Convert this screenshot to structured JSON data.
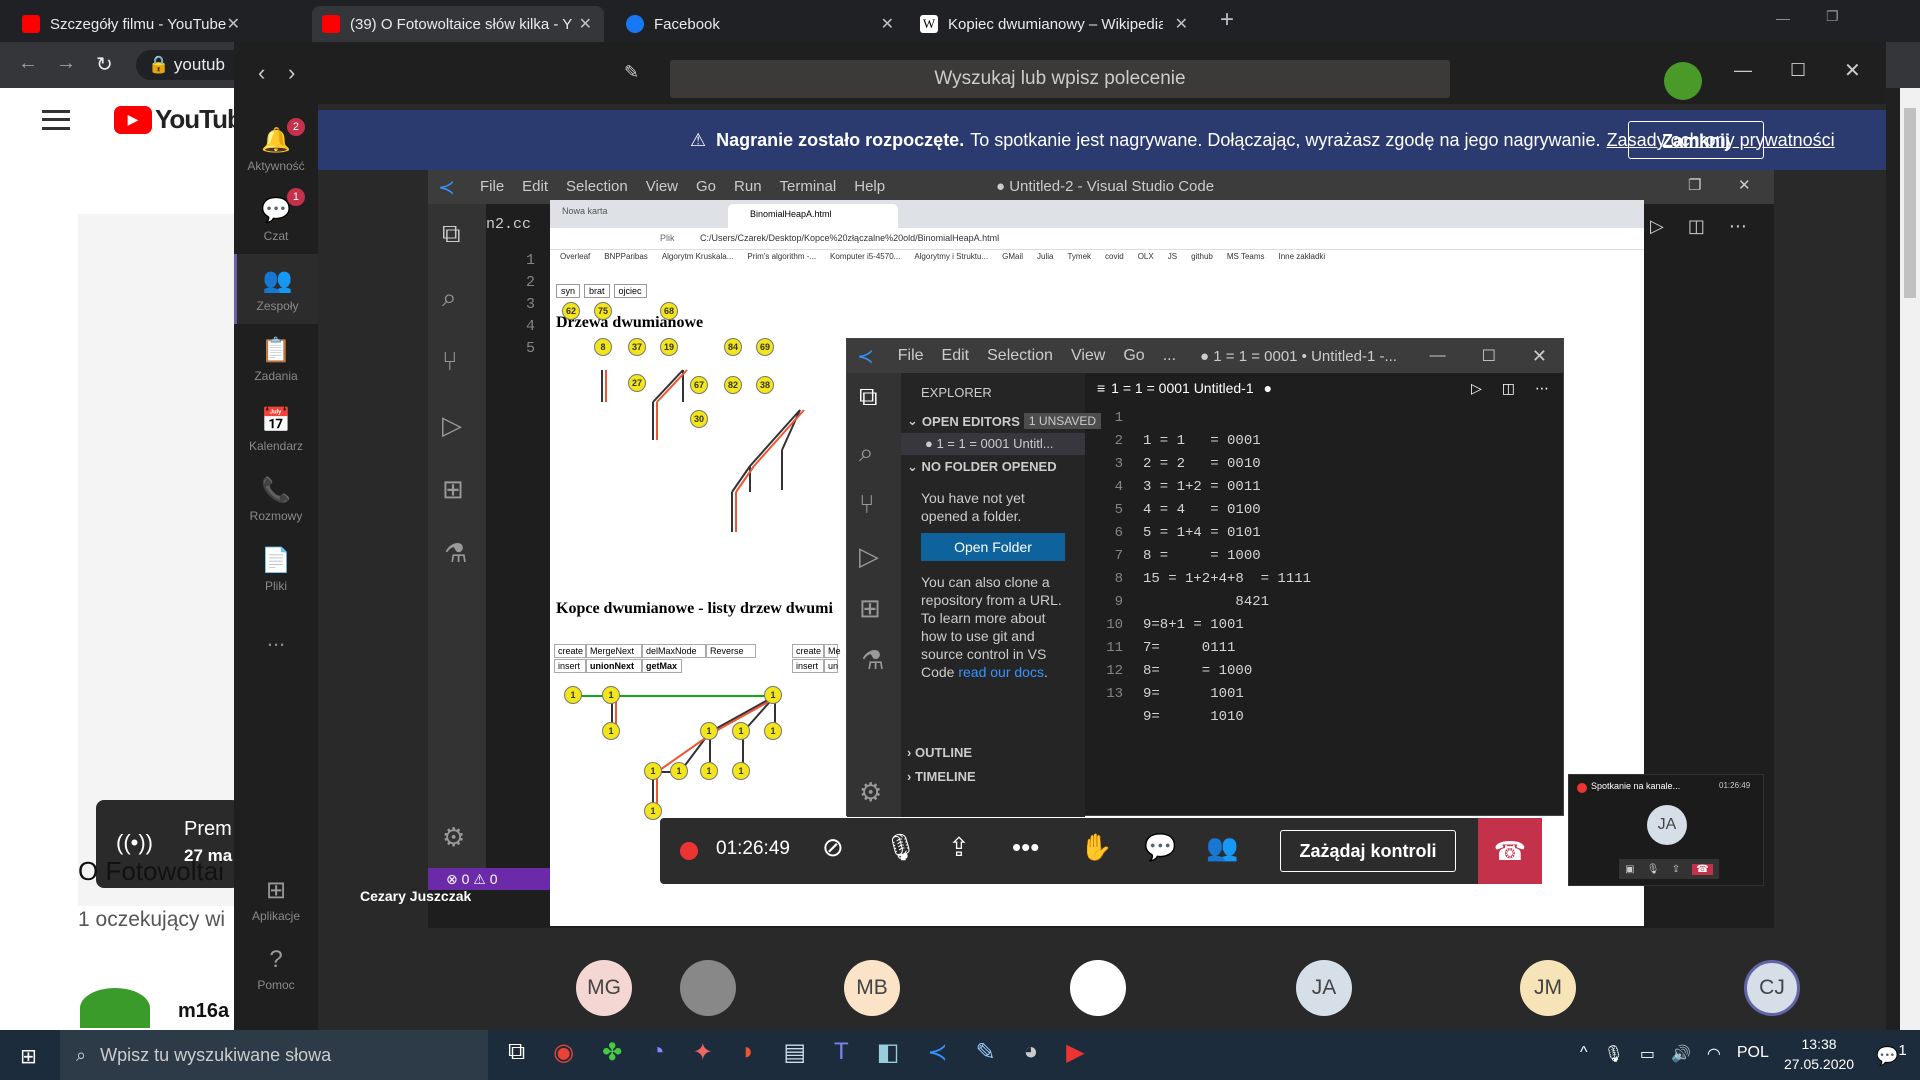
{
  "chrome": {
    "tabs": [
      {
        "title": "Szczegóły filmu - YouTube Studio",
        "favicon_color": "#ff0000",
        "active": false
      },
      {
        "title": "(39) O Fotowoltaice słów kilka - Y",
        "favicon_color": "#ff0000",
        "active": true
      },
      {
        "title": "Facebook",
        "favicon_color": "#1877f2",
        "active": false
      },
      {
        "title": "Kopiec dwumianowy – Wikipedia",
        "favicon_color": "#ffffff",
        "active": false
      }
    ],
    "new_tab": "+",
    "address": "youtub"
  },
  "youtube": {
    "logo": "YouTube",
    "live_label": "Prem",
    "live_date": "27 ma",
    "video_title": "O Fotowoltai",
    "comments": "1 oczekujący wi",
    "channel": "m16a"
  },
  "teams": {
    "search_placeholder": "Wyszukaj lub wpisz polecenie",
    "rail": [
      {
        "label": "Aktywność",
        "icon": "bell-icon",
        "badge": "2"
      },
      {
        "label": "Czat",
        "icon": "chat-icon",
        "badge": "1"
      },
      {
        "label": "Zespoły",
        "icon": "teams-icon",
        "badge": ""
      },
      {
        "label": "Zadania",
        "icon": "tasks-icon",
        "badge": ""
      },
      {
        "label": "Kalendarz",
        "icon": "calendar-icon",
        "badge": ""
      },
      {
        "label": "Rozmowy",
        "icon": "phone-icon",
        "badge": ""
      },
      {
        "label": "Pliki",
        "icon": "files-icon",
        "badge": ""
      },
      {
        "label": "...",
        "icon": "more-icon",
        "badge": ""
      }
    ],
    "rail_bottom": [
      {
        "label": "Aplikacje",
        "icon": "apps-icon"
      },
      {
        "label": "Pomoc",
        "icon": "help-icon"
      }
    ],
    "banner": {
      "bold": "Nagranie zostało rozpoczęte.",
      "text": "To spotkanie jest nagrywane. Dołączając, wyrażasz zgodę na jego nagrywanie.",
      "link": "Zasady ochrony prywatności",
      "button": "Zamknij"
    },
    "presenter": "Cezary Juszczak",
    "call": {
      "time": "01:26:49",
      "request_control": "Zażądaj kontroli"
    },
    "mini_window": {
      "title": "Spotkanie na kanale...",
      "time": "01:26:49",
      "avatar": "JA"
    },
    "participants": [
      {
        "initials": "MG",
        "color": "#f4d7d3"
      },
      {
        "initials": "",
        "color": "#888888"
      },
      {
        "initials": "MB",
        "color": "#fbe3c8"
      },
      {
        "initials": "",
        "color": "#ffffff"
      },
      {
        "initials": "JA",
        "color": "#d6dfe8"
      },
      {
        "initials": "JM",
        "color": "#f6e4b8"
      },
      {
        "initials": "CJ",
        "color": "#d6dfe8"
      }
    ]
  },
  "vscode_back": {
    "menu": [
      "File",
      "Edit",
      "Selection",
      "View",
      "Go",
      "Run",
      "Terminal",
      "Help"
    ],
    "title": "● Untitled-2 - Visual Studio Code",
    "tab_fragment": "n2.cc",
    "line_numbers": [
      "1",
      "2",
      "3",
      "4",
      "5"
    ],
    "status": "⊗ 0 ⚠ 0"
  },
  "browser": {
    "tabs": [
      "Nowa karta",
      "BinomialHeapA.html"
    ],
    "url": "C:/Users/Czarek/Desktop/Kopce%20złączalne%20old/BinomialHeapA.html",
    "url_prefix": "Plik",
    "bookmarks": [
      "Overleaf",
      "BNPParibas",
      "Algorytm Kruskala...",
      "Prim's algorithm -...",
      "Komputer i5-4570...",
      "Algorytmy i Struktu...",
      "GMail",
      "Julia",
      "Tymek",
      "covid",
      "OLX",
      "JS",
      "github",
      "MS Teams",
      "Inne zakładki"
    ],
    "buttons": [
      "syn",
      "brat",
      "ojciec"
    ],
    "heading1": "Drzewa dwumianowe",
    "heading2": "Kopce dwumianowe - listy drzew dwumi",
    "ops_row1": [
      "create",
      "MergeNext",
      "delMaxNode",
      "Reverse"
    ],
    "ops_row2": [
      "insert",
      "unionNext",
      "getMax"
    ],
    "ops2_row1": [
      "create",
      "Me"
    ],
    "ops2_row2": [
      "insert",
      "un"
    ],
    "tree_nodes": [
      "62",
      "75",
      "8",
      "68",
      "37",
      "19",
      "27",
      "84",
      "69",
      "67",
      "82",
      "38",
      "30"
    ],
    "heap_nodes": [
      "1",
      "1",
      "1",
      "1",
      "1",
      "1",
      "1",
      "1",
      "1",
      "1",
      "1",
      "1",
      "1"
    ]
  },
  "vscode_front": {
    "menu": [
      "File",
      "Edit",
      "Selection",
      "View",
      "Go",
      "..."
    ],
    "title": "● 1 = 1  = 0001 • Untitled-1 -...",
    "explorer": "EXPLORER",
    "open_editors": "OPEN EDITORS",
    "unsaved": "1 UNSAVED",
    "open_file": "1 = 1   = 0001  Untitl...",
    "no_folder": "NO FOLDER OPENED",
    "no_folder_msg": "You have not yet opened a folder.",
    "open_folder_btn": "Open Folder",
    "clone_msg": "You can also clone a repository from a URL. To learn more about how to use git and source control in VS Code",
    "read_docs": "read our docs",
    "outline": "OUTLINE",
    "timeline": "TIMELINE",
    "editor_tab": "1 = 1   = 0001  Untitled-1",
    "lines": [
      "1 = 1   = 0001",
      "2 = 2   = 0010",
      "3 = 1+2 = 0011",
      "4 = 4   = 0100",
      "5 = 1+4 = 0101",
      "8 =     = 1000",
      "15 = 1+2+4+8  = 1111",
      "           8421",
      "9=8+1 = 1001",
      "7=     0111",
      "8=     = 1000",
      "9=      1001",
      "9=      1010"
    ]
  },
  "taskbar": {
    "search": "Wpisz tu wyszukiwane słowa",
    "lang": "POL",
    "time": "13:38",
    "date": "27.05.2020",
    "notif": "1"
  }
}
